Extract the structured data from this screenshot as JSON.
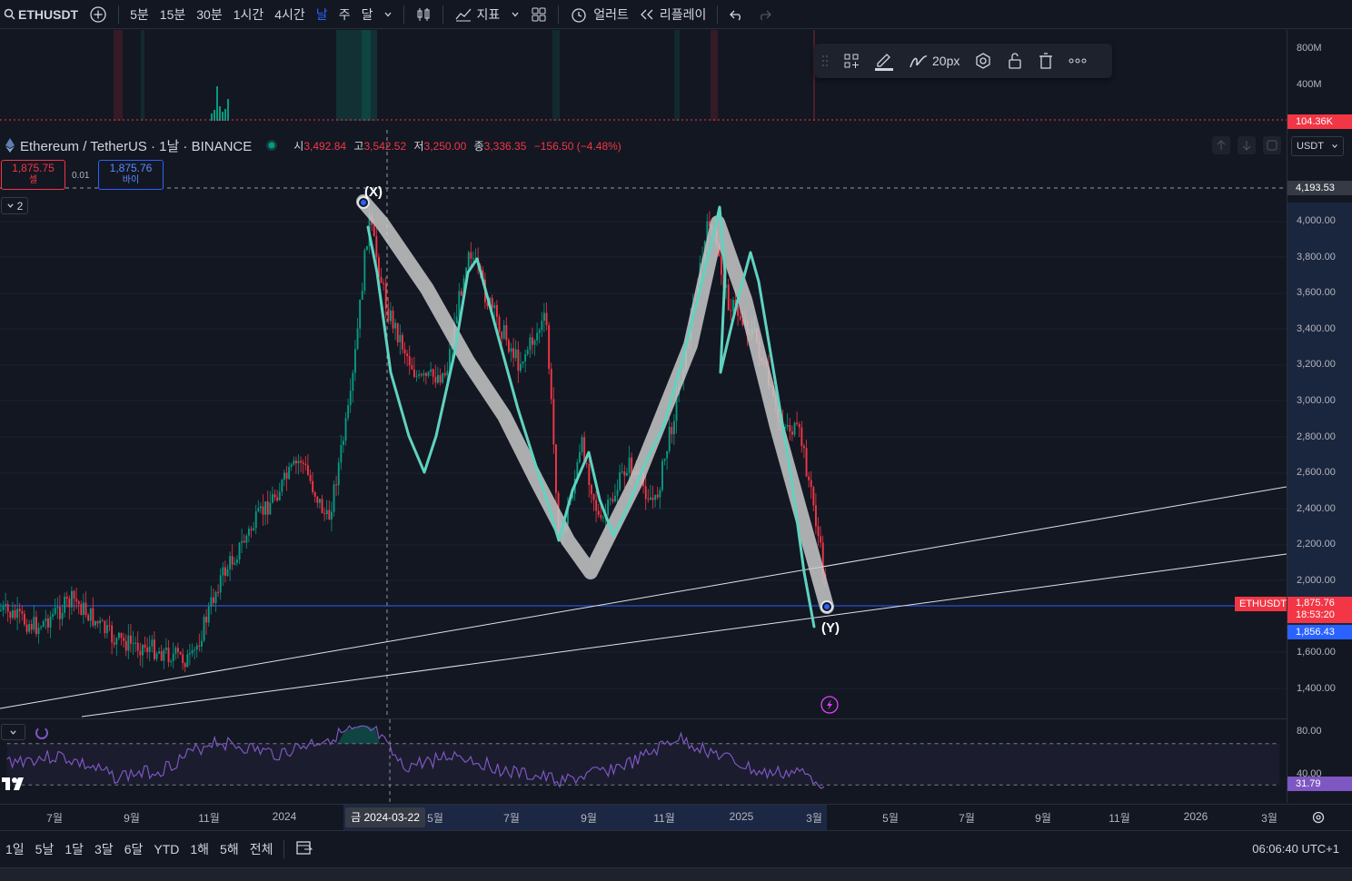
{
  "toolbar": {
    "symbol": "ETHUSDT",
    "intervals": [
      "5분",
      "15분",
      "30분",
      "1시간",
      "4시간",
      "날",
      "주",
      "달"
    ],
    "active_interval": "날",
    "indicators_label": "지표",
    "alert_label": "얼러트",
    "replay_label": "리플레이"
  },
  "legend": {
    "title": "Ethereum / TetherUS · 1날 · BINANCE",
    "open_label": "시",
    "open": "3,492.84",
    "high_label": "고",
    "high": "3,542.52",
    "low_label": "저",
    "low": "3,250.00",
    "close_label": "종",
    "close": "3,336.35",
    "change": "−156.50 (−4.48%)"
  },
  "trade": {
    "sell_price": "1,875.75",
    "sell_label": "셀",
    "spread": "0.01",
    "buy_price": "1,875.76",
    "buy_label": "바이",
    "collapse_count": "2"
  },
  "drawing_toolbar": {
    "width_label": "20px"
  },
  "price_axis": {
    "currency": "USDT",
    "volume_labels": [
      "800M",
      "400M"
    ],
    "volume_marker": "104.36K",
    "labels": [
      "4,000.00",
      "3,800.00",
      "3,600.00",
      "3,400.00",
      "3,200.00",
      "3,000.00",
      "2,800.00",
      "2,600.00",
      "2,400.00",
      "2,200.00",
      "2,000.00",
      "1,600.00",
      "1,400.00"
    ],
    "high_marker": "4,193.53",
    "current_price": "1,875.76",
    "countdown": "18:53:20",
    "blue_marker": "1,856.43",
    "symbol_tag": "ETHUSDT",
    "rsi_labels": [
      "80.00",
      "40.00"
    ],
    "rsi_value": "31.79"
  },
  "annotations": {
    "x_label": "(X)",
    "y_label": "(Y)"
  },
  "time_axis": {
    "labels": [
      "7월",
      "9월",
      "11월",
      "2024",
      "5월",
      "7월",
      "9월",
      "11월",
      "2025",
      "3월",
      "5월",
      "7월",
      "9월",
      "11월",
      "2026",
      "3월"
    ],
    "cursor_date": "금 2024-03-22"
  },
  "bottom": {
    "ranges": [
      "1일",
      "5날",
      "1달",
      "3달",
      "6달",
      "YTD",
      "1해",
      "5해",
      "전체"
    ],
    "clock": "06:06:40 UTC+1"
  },
  "colors": {
    "background": "#131722",
    "up": "#089981",
    "down": "#f23645",
    "wave": "#5fd3c0",
    "accent": "#2962ff",
    "rsi": "#7e57c2"
  }
}
